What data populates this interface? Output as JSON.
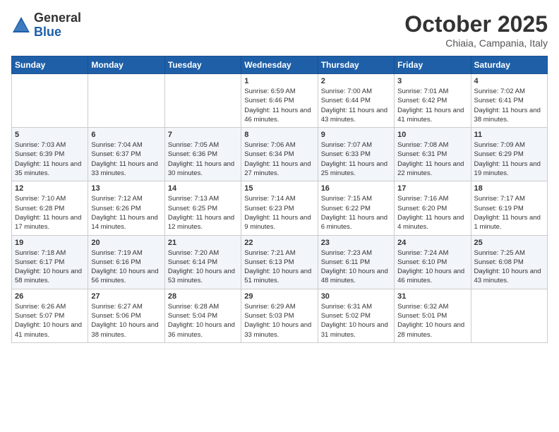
{
  "header": {
    "logo_general": "General",
    "logo_blue": "Blue",
    "month_title": "October 2025",
    "location": "Chiaia, Campania, Italy"
  },
  "weekdays": [
    "Sunday",
    "Monday",
    "Tuesday",
    "Wednesday",
    "Thursday",
    "Friday",
    "Saturday"
  ],
  "weeks": [
    [
      {
        "day": "",
        "info": ""
      },
      {
        "day": "",
        "info": ""
      },
      {
        "day": "",
        "info": ""
      },
      {
        "day": "1",
        "info": "Sunrise: 6:59 AM\nSunset: 6:46 PM\nDaylight: 11 hours and 46 minutes."
      },
      {
        "day": "2",
        "info": "Sunrise: 7:00 AM\nSunset: 6:44 PM\nDaylight: 11 hours and 43 minutes."
      },
      {
        "day": "3",
        "info": "Sunrise: 7:01 AM\nSunset: 6:42 PM\nDaylight: 11 hours and 41 minutes."
      },
      {
        "day": "4",
        "info": "Sunrise: 7:02 AM\nSunset: 6:41 PM\nDaylight: 11 hours and 38 minutes."
      }
    ],
    [
      {
        "day": "5",
        "info": "Sunrise: 7:03 AM\nSunset: 6:39 PM\nDaylight: 11 hours and 35 minutes."
      },
      {
        "day": "6",
        "info": "Sunrise: 7:04 AM\nSunset: 6:37 PM\nDaylight: 11 hours and 33 minutes."
      },
      {
        "day": "7",
        "info": "Sunrise: 7:05 AM\nSunset: 6:36 PM\nDaylight: 11 hours and 30 minutes."
      },
      {
        "day": "8",
        "info": "Sunrise: 7:06 AM\nSunset: 6:34 PM\nDaylight: 11 hours and 27 minutes."
      },
      {
        "day": "9",
        "info": "Sunrise: 7:07 AM\nSunset: 6:33 PM\nDaylight: 11 hours and 25 minutes."
      },
      {
        "day": "10",
        "info": "Sunrise: 7:08 AM\nSunset: 6:31 PM\nDaylight: 11 hours and 22 minutes."
      },
      {
        "day": "11",
        "info": "Sunrise: 7:09 AM\nSunset: 6:29 PM\nDaylight: 11 hours and 19 minutes."
      }
    ],
    [
      {
        "day": "12",
        "info": "Sunrise: 7:10 AM\nSunset: 6:28 PM\nDaylight: 11 hours and 17 minutes."
      },
      {
        "day": "13",
        "info": "Sunrise: 7:12 AM\nSunset: 6:26 PM\nDaylight: 11 hours and 14 minutes."
      },
      {
        "day": "14",
        "info": "Sunrise: 7:13 AM\nSunset: 6:25 PM\nDaylight: 11 hours and 12 minutes."
      },
      {
        "day": "15",
        "info": "Sunrise: 7:14 AM\nSunset: 6:23 PM\nDaylight: 11 hours and 9 minutes."
      },
      {
        "day": "16",
        "info": "Sunrise: 7:15 AM\nSunset: 6:22 PM\nDaylight: 11 hours and 6 minutes."
      },
      {
        "day": "17",
        "info": "Sunrise: 7:16 AM\nSunset: 6:20 PM\nDaylight: 11 hours and 4 minutes."
      },
      {
        "day": "18",
        "info": "Sunrise: 7:17 AM\nSunset: 6:19 PM\nDaylight: 11 hours and 1 minute."
      }
    ],
    [
      {
        "day": "19",
        "info": "Sunrise: 7:18 AM\nSunset: 6:17 PM\nDaylight: 10 hours and 58 minutes."
      },
      {
        "day": "20",
        "info": "Sunrise: 7:19 AM\nSunset: 6:16 PM\nDaylight: 10 hours and 56 minutes."
      },
      {
        "day": "21",
        "info": "Sunrise: 7:20 AM\nSunset: 6:14 PM\nDaylight: 10 hours and 53 minutes."
      },
      {
        "day": "22",
        "info": "Sunrise: 7:21 AM\nSunset: 6:13 PM\nDaylight: 10 hours and 51 minutes."
      },
      {
        "day": "23",
        "info": "Sunrise: 7:23 AM\nSunset: 6:11 PM\nDaylight: 10 hours and 48 minutes."
      },
      {
        "day": "24",
        "info": "Sunrise: 7:24 AM\nSunset: 6:10 PM\nDaylight: 10 hours and 46 minutes."
      },
      {
        "day": "25",
        "info": "Sunrise: 7:25 AM\nSunset: 6:08 PM\nDaylight: 10 hours and 43 minutes."
      }
    ],
    [
      {
        "day": "26",
        "info": "Sunrise: 6:26 AM\nSunset: 5:07 PM\nDaylight: 10 hours and 41 minutes."
      },
      {
        "day": "27",
        "info": "Sunrise: 6:27 AM\nSunset: 5:06 PM\nDaylight: 10 hours and 38 minutes."
      },
      {
        "day": "28",
        "info": "Sunrise: 6:28 AM\nSunset: 5:04 PM\nDaylight: 10 hours and 36 minutes."
      },
      {
        "day": "29",
        "info": "Sunrise: 6:29 AM\nSunset: 5:03 PM\nDaylight: 10 hours and 33 minutes."
      },
      {
        "day": "30",
        "info": "Sunrise: 6:31 AM\nSunset: 5:02 PM\nDaylight: 10 hours and 31 minutes."
      },
      {
        "day": "31",
        "info": "Sunrise: 6:32 AM\nSunset: 5:01 PM\nDaylight: 10 hours and 28 minutes."
      },
      {
        "day": "",
        "info": ""
      }
    ]
  ]
}
